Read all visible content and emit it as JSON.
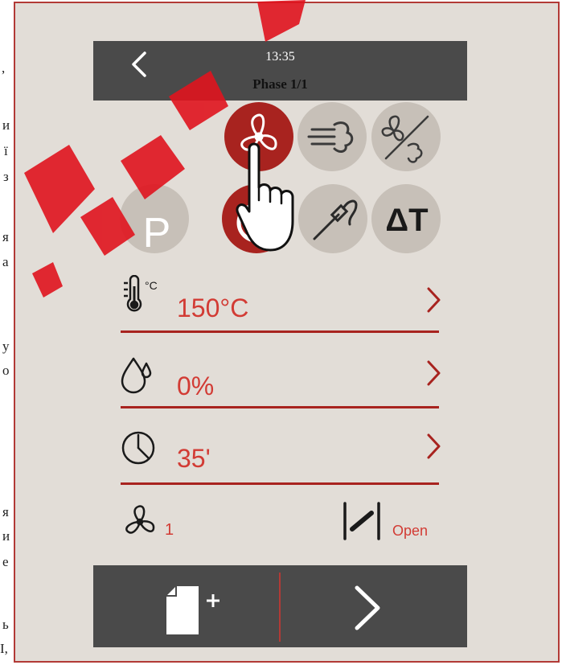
{
  "header": {
    "time": "13:35",
    "phase": "Phase 1/1"
  },
  "modes": {
    "row1": [
      "fan-icon",
      "steam-icon",
      "fan-steam-off-icon"
    ],
    "row2": [
      "p-icon",
      "combi-icon",
      "core-probe-icon",
      "delta-t-icon"
    ],
    "p_label": "P",
    "delta_label": "ΔT"
  },
  "params": {
    "temperature": "150°C",
    "temperature_unit": "°C",
    "humidity": "0%",
    "time": "35'"
  },
  "footer": {
    "fan_speed": "1",
    "vent_status": "Open"
  },
  "doc_fragments": [
    ",",
    "и",
    "ї",
    "з",
    "я",
    "а",
    "у",
    "о",
    "я",
    "и",
    "е",
    "ь",
    "І,"
  ],
  "colors": {
    "accent": "#a8231f",
    "value_red": "#d23b34",
    "panel_bg": "#e2ddd7",
    "dark_bar": "#4a4a4a",
    "button_gray": "#c7c0b8"
  }
}
